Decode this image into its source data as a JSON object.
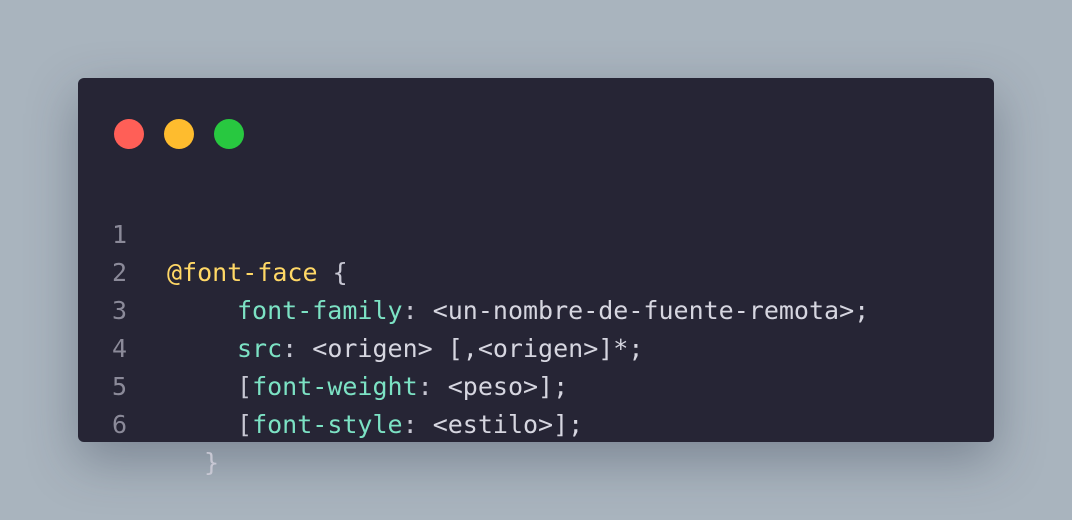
{
  "window": {
    "buttons": [
      "close",
      "minimize",
      "maximize"
    ]
  },
  "code": {
    "lines": [
      {
        "num": "1",
        "at_rule": "@font-face",
        "brace": " {"
      },
      {
        "num": "2",
        "prop": "font-family",
        "colon": ":",
        "value": " <un-nombre-de-fuente-remota>;"
      },
      {
        "num": "3",
        "prop": "src",
        "colon": ":",
        "value": " <origen> [,<origen>]*;"
      },
      {
        "num": "4",
        "open": "[",
        "prop": "font-weight",
        "colon": ":",
        "value": " <peso>];"
      },
      {
        "num": "5",
        "open": "[",
        "prop": "font-style",
        "colon": ":",
        "value": " <estilo>];"
      },
      {
        "num": "6",
        "close": "}"
      }
    ]
  },
  "colors": {
    "background": "#a9b4be",
    "window": "#262535",
    "at_rule": "#ffd866",
    "property": "#7ce2c4",
    "text": "#d6d6e0",
    "line_number": "#8b8a99",
    "close": "#ff5f57",
    "minimize": "#febc2e",
    "maximize": "#28c840"
  }
}
